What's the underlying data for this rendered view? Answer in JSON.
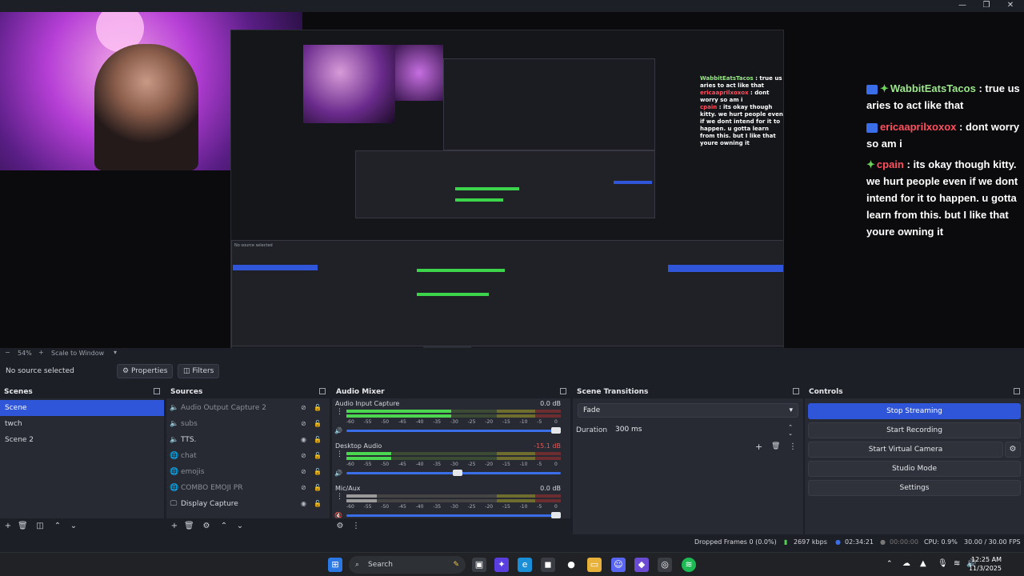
{
  "window": {
    "minimize": "—",
    "maximize": "❐",
    "close": "✕"
  },
  "chat": [
    {
      "user": "WabbitEatsTacos",
      "text": ": true us aries to act like that",
      "color": "#9be88a"
    },
    {
      "user": "ericaaprilxoxox",
      "text": ": dont worry so am i",
      "color": "#ff4f5e"
    },
    {
      "user": "cpain",
      "text": ": its okay though kitty. we hurt people even if we dont intend for it to happen. u gotta learn from this. but I like that youre owning it",
      "color": "#ff4f5e"
    }
  ],
  "zoom": {
    "value": "54%",
    "scale_label": "Scale to Window"
  },
  "source_bar": {
    "no_source": "No source selected",
    "properties": "Properties",
    "filters": "Filters"
  },
  "scenes": {
    "title": "Scenes",
    "items": [
      "Scene",
      "twch",
      "Scene 2"
    ],
    "selected": 0
  },
  "sources": {
    "title": "Sources",
    "items": [
      {
        "label": "Audio Output Capture 2",
        "icon": "speaker-icon",
        "visible": false
      },
      {
        "label": "subs",
        "icon": "speaker-icon",
        "visible": false
      },
      {
        "label": "TTS.",
        "icon": "speaker-icon",
        "visible": true
      },
      {
        "label": "chat",
        "icon": "globe-icon",
        "visible": false
      },
      {
        "label": "emojis",
        "icon": "globe-icon",
        "visible": false
      },
      {
        "label": "COMBO EMOJI PR",
        "icon": "globe-icon",
        "visible": false
      },
      {
        "label": "Display Capture",
        "icon": "monitor-icon",
        "visible": true
      }
    ]
  },
  "mixer": {
    "title": "Audio Mixer",
    "channels": [
      {
        "name": "Audio Input Capture",
        "db": "0.0 dB",
        "level": 0.7,
        "volume": 1.0,
        "muted": false
      },
      {
        "name": "Desktop Audio",
        "db": "-15.1 dB",
        "level": 0.3,
        "volume": 0.54,
        "muted": false
      },
      {
        "name": "Mic/Aux",
        "db": "0.0 dB",
        "level": 0.2,
        "volume": 1.0,
        "muted": true
      }
    ],
    "ticks": [
      "-60",
      "-55",
      "-50",
      "-45",
      "-40",
      "-35",
      "-30",
      "-25",
      "-20",
      "-15",
      "-10",
      "-5",
      "0"
    ]
  },
  "transitions": {
    "title": "Scene Transitions",
    "selected": "Fade",
    "duration_label": "Duration",
    "duration_value": "300 ms"
  },
  "controls": {
    "title": "Controls",
    "buttons": [
      "Stop Streaming",
      "Start Recording",
      "Start Virtual Camera",
      "Studio Mode",
      "Settings"
    ]
  },
  "status": {
    "dropped": "Dropped Frames 0 (0.0%)",
    "kbps": "2697 kbps",
    "stream_time": "02:34:21",
    "rec_time": "00:00:00",
    "cpu": "CPU: 0.9%",
    "fps": "30.00 / 30.00 FPS"
  },
  "taskbar": {
    "search": "Search",
    "time": "12:25 AM",
    "date": "11/3/2025"
  }
}
